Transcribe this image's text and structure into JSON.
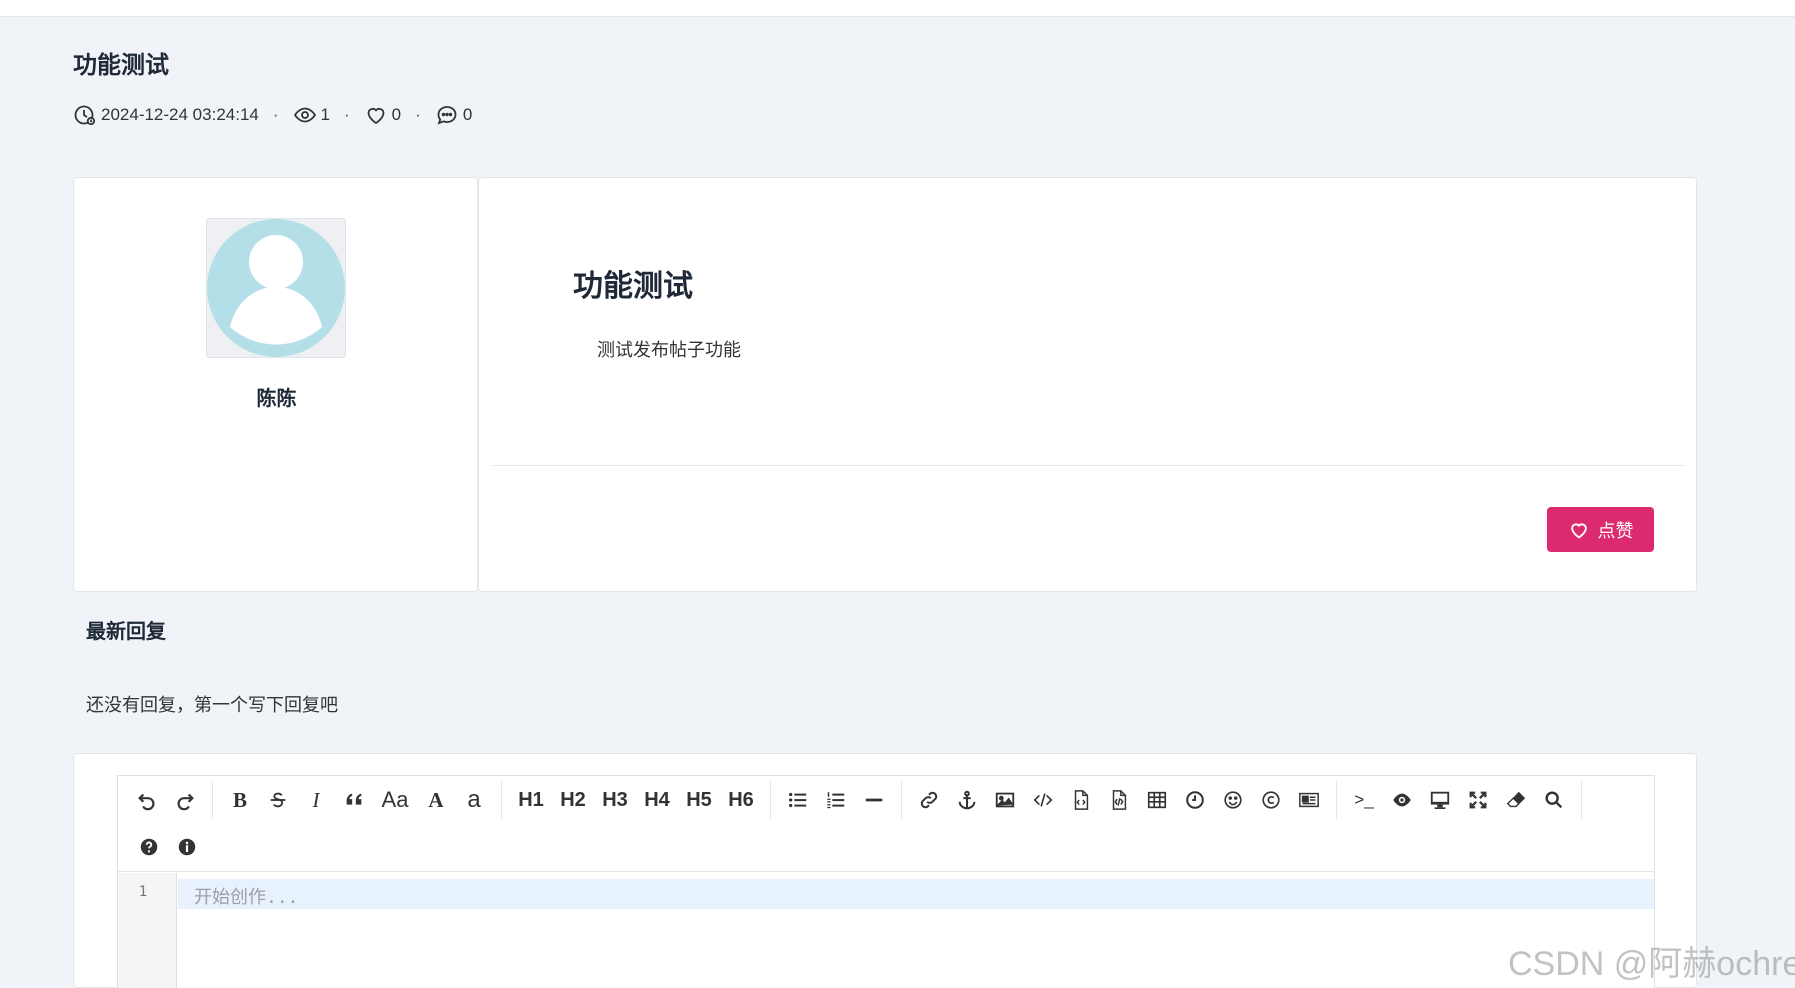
{
  "page": {
    "title": "功能测试",
    "meta": {
      "datetime": "2024-12-24 03:24:14",
      "views": "1",
      "likes": "0",
      "comments": "0",
      "separator": "·"
    }
  },
  "author": {
    "name": "陈陈"
  },
  "post": {
    "heading": "功能测试",
    "body": "测试发布帖子功能",
    "like_label": "点赞",
    "like_color": "#db2a6e"
  },
  "replies": {
    "title": "最新回复",
    "empty_text": "还没有回复，第一个写下回复吧"
  },
  "editor": {
    "toolbar_headings": [
      "H1",
      "H2",
      "H3",
      "H4",
      "H5",
      "H6"
    ],
    "bold_label": "B",
    "italic_label": "I",
    "case_label": "Aa",
    "upper_label": "A",
    "lower_label": "a",
    "terminal_label": ">_",
    "line_number": "1",
    "placeholder": "开始创作..."
  },
  "watermark": "CSDN @阿赫ochre"
}
